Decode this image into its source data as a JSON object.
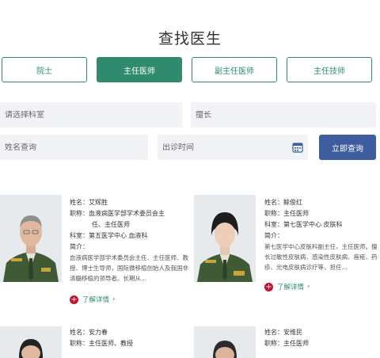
{
  "page_title": "查找医生",
  "tabs": [
    {
      "label": "院士"
    },
    {
      "label": "主任医师"
    },
    {
      "label": "副主任医师"
    },
    {
      "label": "主任技师"
    }
  ],
  "filters": {
    "department_placeholder": "请选择科室",
    "specialty_placeholder": "擅长",
    "name_placeholder": "姓名查询",
    "time_placeholder": "出诊时间",
    "search_button": "立即查询"
  },
  "doctors": [
    {
      "name": "姓名：艾辉胜",
      "title_line1": "职称：血液病医学部学术委员会主",
      "title_line2": "任、主任医师",
      "dept": "科室：第五医学中心 血液科",
      "intro_label": "简介：",
      "intro": "血液病医学部学术委员会主任、主任医师、教授、博士生导师，国际微移植创始人及我国非清髓移植的领导者。长期从...",
      "more": "了解详情"
    },
    {
      "name": "姓名：鲸俊红",
      "title_line1": "职称：主任医师",
      "title_line2": "",
      "dept": "科室：第七医学中心 皮肤科",
      "intro_label": "简介：",
      "intro": "第七医学中心皮肤科副主任，主任医师。擅长过敏性皮肤病、感染性皮肤病、痤疮、药疹、光电皮肤病诊疗等，担任...",
      "more": "了解详情"
    },
    {
      "name": "姓名：安力春",
      "title_line1": "职称：主任医师、教授",
      "title_line2": "",
      "dept": "",
      "intro_label": "",
      "intro": "",
      "more": ""
    },
    {
      "name": "姓名：安维民",
      "title_line1": "职称：主任医师",
      "title_line2": "",
      "dept": "",
      "intro_label": "",
      "intro": "",
      "more": ""
    }
  ],
  "colors": {
    "accent": "#2f8a6e",
    "button": "#3d5d9e",
    "link_icon": "#c8102e"
  }
}
